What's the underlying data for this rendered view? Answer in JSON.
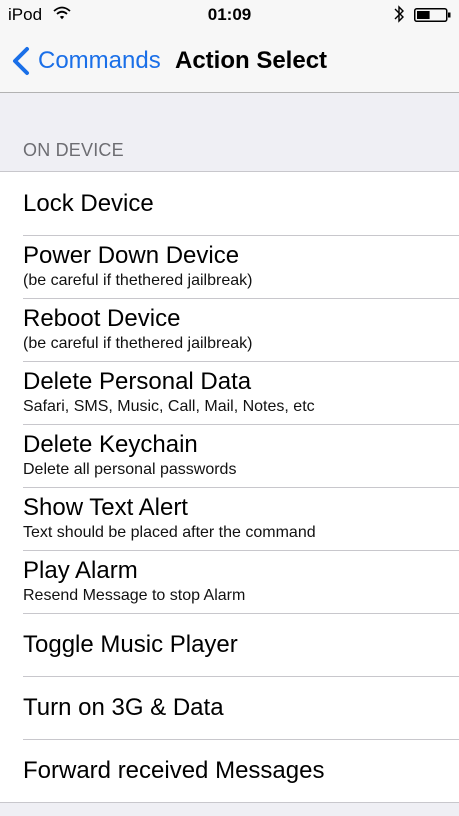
{
  "status_bar": {
    "carrier": "iPod",
    "time": "01:09",
    "wifi_icon": "wifi-icon",
    "bluetooth_icon": "bluetooth-icon",
    "battery_icon": "battery-icon",
    "battery_level": 0.45
  },
  "nav": {
    "back_label": "Commands",
    "title": "Action Select",
    "accent_color": "#1a6fe8"
  },
  "section": {
    "header": "ON DEVICE"
  },
  "items": [
    {
      "title": "Lock Device"
    },
    {
      "title": "Power Down Device",
      "subtitle": "(be careful if thethered jailbreak)"
    },
    {
      "title": "Reboot Device",
      "subtitle": "(be careful if thethered jailbreak)"
    },
    {
      "title": "Delete Personal Data",
      "subtitle": "Safari, SMS, Music, Call, Mail, Notes, etc"
    },
    {
      "title": "Delete Keychain",
      "subtitle": "Delete all personal passwords"
    },
    {
      "title": "Show Text Alert",
      "subtitle": "Text should be placed after the command"
    },
    {
      "title": "Play Alarm",
      "subtitle": "Resend Message to stop Alarm"
    },
    {
      "title": "Toggle Music Player"
    },
    {
      "title": "Turn on 3G & Data"
    },
    {
      "title": "Forward received Messages"
    }
  ]
}
